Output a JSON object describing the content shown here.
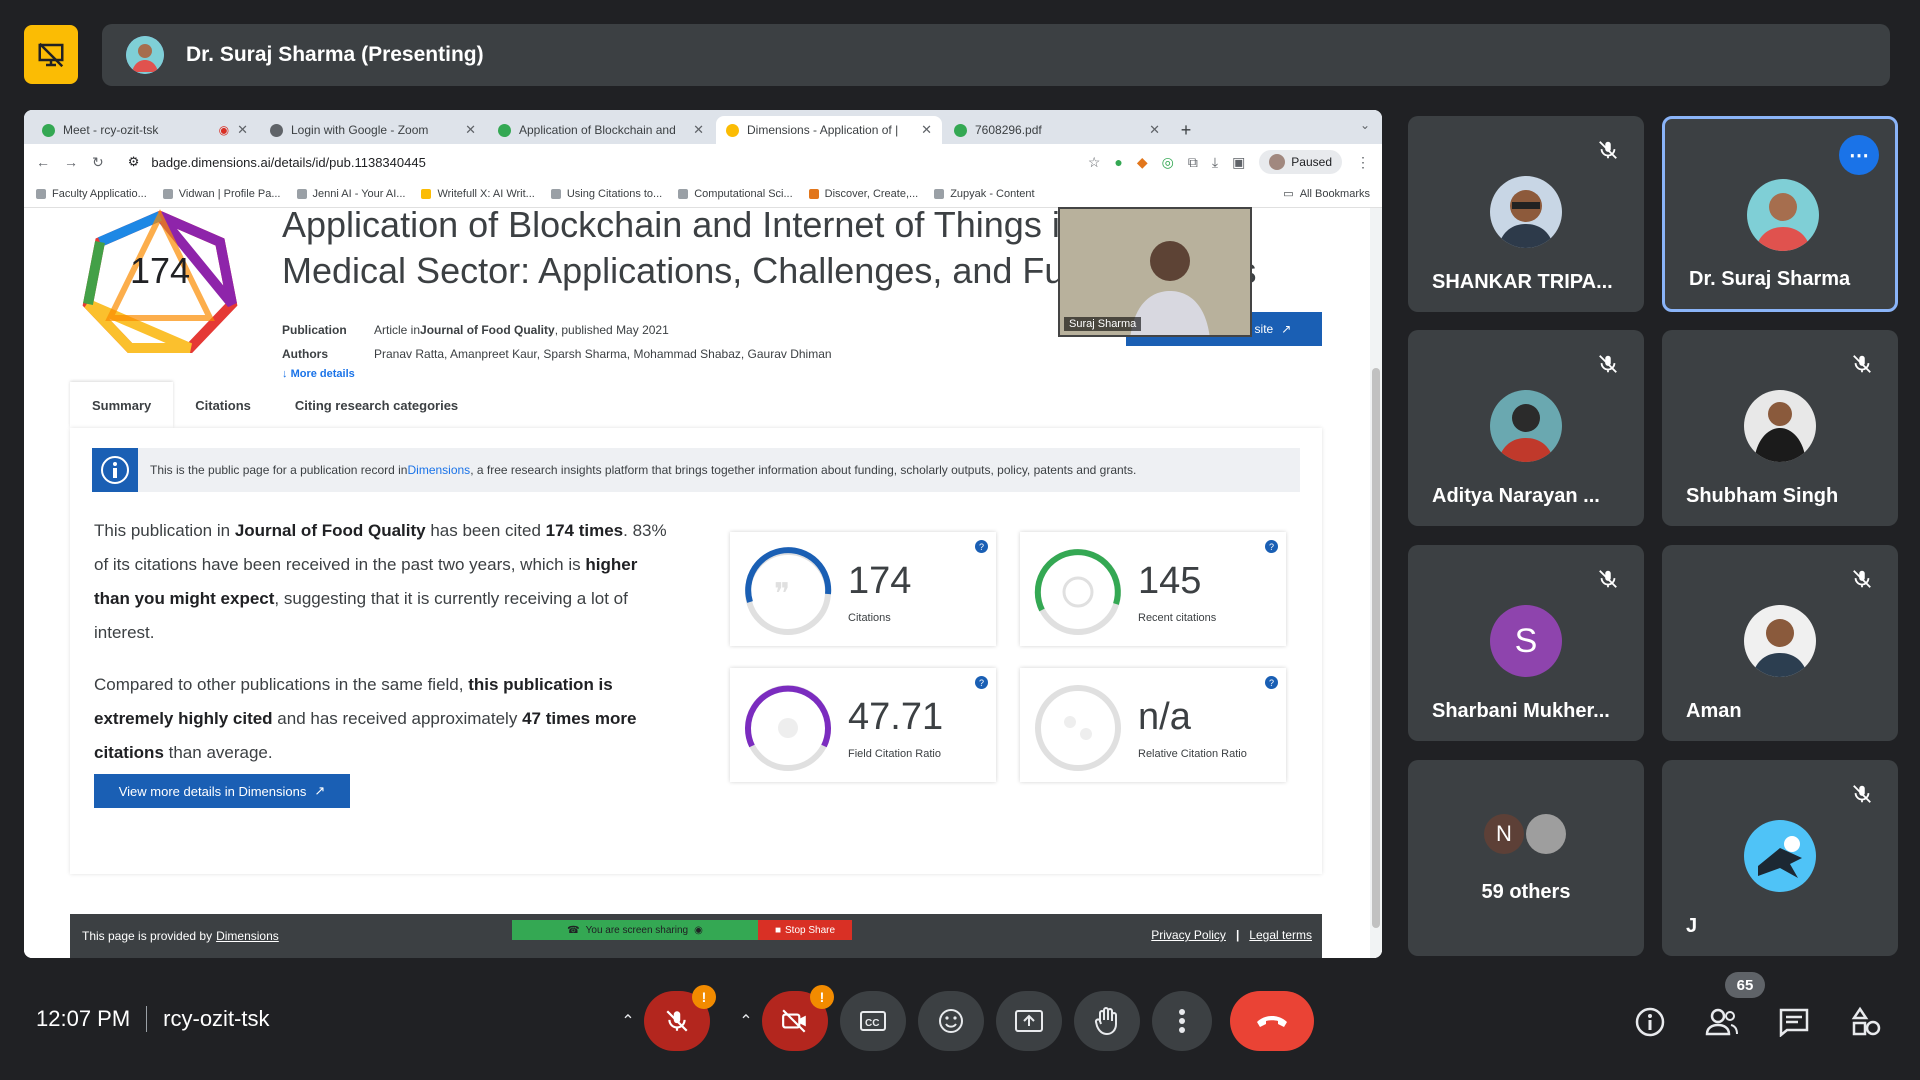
{
  "meeting": {
    "presenter_label": "Dr. Suraj Sharma (Presenting)",
    "time": "12:07 PM",
    "code": "rcy-ozit-tsk",
    "participant_count": "65"
  },
  "browser": {
    "tabs": [
      {
        "label": "Meet - rcy-ozit-tsk",
        "active": false
      },
      {
        "label": "Login with Google - Zoom",
        "active": false
      },
      {
        "label": "Application of Blockchain and",
        "active": false
      },
      {
        "label": "Dimensions - Application of |",
        "active": true
      },
      {
        "label": "7608296.pdf",
        "active": false
      }
    ],
    "url": "badge.dimensions.ai/details/id/pub.1138340445",
    "profile_status": "Paused",
    "bookmarks": [
      "Faculty Applicatio...",
      "Vidwan | Profile Pa...",
      "Jenni AI - Your AI...",
      "Writefull X: AI Writ...",
      "Using Citations to...",
      "Computational Sci...",
      "Discover, Create,...",
      "Zupyak - Content"
    ],
    "all_bookmarks": "All Bookmarks"
  },
  "page": {
    "badge_score": "174",
    "title": "Application of Blockchain and Internet of Things in Food and Medical Sector: Applications, Challenges, and Future Scopes",
    "publication_label": "Publication",
    "publication_prefix": "Article in ",
    "publication_journal": "Journal of Food Quality",
    "publication_suffix": ", published May 2021",
    "authors_label": "Authors",
    "authors": "Pranav Ratta, Amanpreet Kaur, Sparsh Sharma, Mohammad Shabaz, Gaurav Dhiman",
    "more_details": "More details",
    "publisher_button": "View on publisher site",
    "tabs": [
      "Summary",
      "Citations",
      "Citing research categories"
    ],
    "info_prefix": "This is the public page for a publication record in ",
    "info_link": "Dimensions",
    "info_suffix": ", a free research insights platform that brings together information about funding, scholarly outputs, policy, patents and grants.",
    "p1_a": "This publication in ",
    "p1_b": "Journal of Food Quality",
    "p1_c": " has been cited ",
    "p1_d": "174 times",
    "p1_e": ". 83% of its citations have been received in the past two years, which is ",
    "p1_f": "higher than you might expect",
    "p1_g": ", suggesting that it is currently receiving a lot of interest.",
    "p2_a": "Compared to other publications in the same field, ",
    "p2_b": "this publication is extremely highly cited",
    "p2_c": " and has received approximately ",
    "p2_d": "47 times more citations",
    "p2_e": " than average.",
    "view_more": "View more details in Dimensions",
    "metrics": [
      {
        "value": "174",
        "label": "Citations",
        "color": "#1a5fb4"
      },
      {
        "value": "145",
        "label": "Recent citations",
        "color": "#34a853"
      },
      {
        "value": "47.71",
        "label": "Field Citation Ratio",
        "color": "#7b2cbf"
      },
      {
        "value": "n/a",
        "label": "Relative Citation Ratio",
        "color": "#bdbdbd"
      }
    ],
    "footer_prefix": "This page is provided by ",
    "footer_link": "Dimensions",
    "screen_sharing": "You are screen sharing",
    "stop_share": "Stop Share",
    "privacy": "Privacy Policy",
    "legal": "Legal terms",
    "pip_name": "Suraj Sharma"
  },
  "participants": [
    {
      "name": "SHANKAR TRIPA...",
      "muted": true
    },
    {
      "name": "Dr. Suraj Sharma",
      "muted": false,
      "speaking": true
    },
    {
      "name": "Aditya Narayan ...",
      "muted": true
    },
    {
      "name": "Shubham Singh",
      "muted": true
    },
    {
      "name": "Sharbani Mukher...",
      "initial": "S",
      "muted": true
    },
    {
      "name": "Aman",
      "muted": true
    },
    {
      "name": "59 others",
      "initial": "N"
    },
    {
      "name": "J",
      "muted": true
    }
  ]
}
